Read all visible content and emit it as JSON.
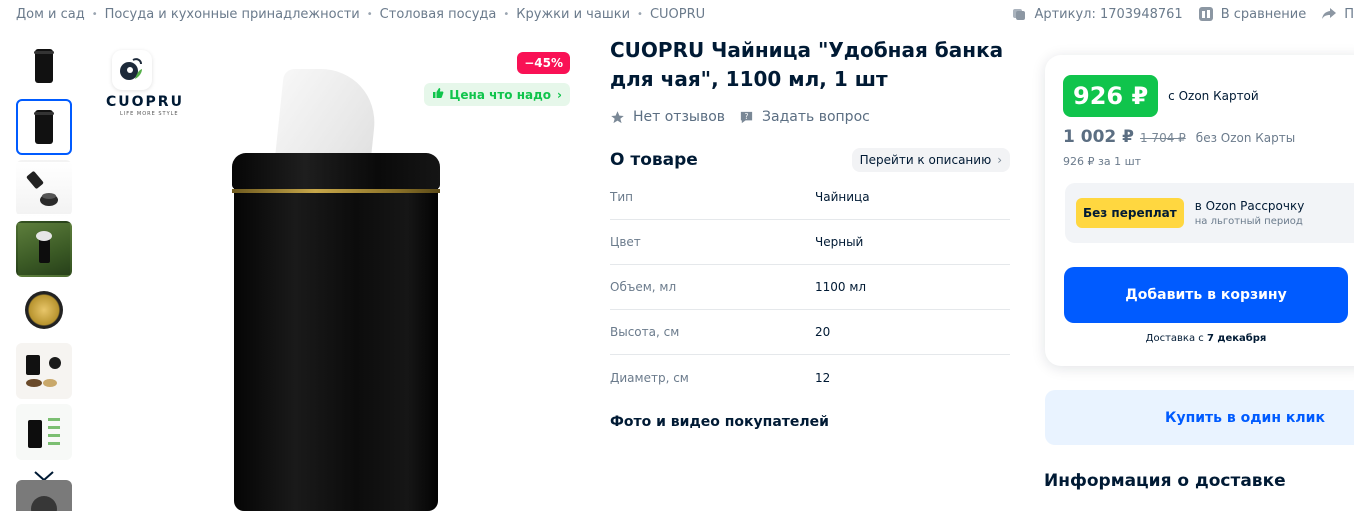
{
  "breadcrumbs": [
    "Дом и сад",
    "Посуда и кухонные принадлежности",
    "Столовая посуда",
    "Кружки и чашки",
    "CUOPRU"
  ],
  "top_actions": {
    "article": "Артикул: 1703948761",
    "compare": "В сравнение",
    "share": "П"
  },
  "gallery": {
    "thumbnails": [
      "thumb-1",
      "thumb-2",
      "thumb-3",
      "thumb-4",
      "thumb-5",
      "thumb-6",
      "thumb-7"
    ],
    "active_index": 1,
    "brand_name": "CUOPRU",
    "brand_tagline": "LIFE MORE STYLE",
    "discount_badge": "−45%",
    "good_price_badge": "Цена что надо"
  },
  "product": {
    "title": "CUOPRU Чайница \"Удобная банка для чая\", 1100 мл, 1 шт",
    "reviews": "Нет отзывов",
    "ask_question": "Задать вопрос"
  },
  "about": {
    "title": "О товаре",
    "goto_description": "Перейти к описанию",
    "specs": [
      {
        "key": "Тип",
        "value": "Чайница"
      },
      {
        "key": "Цвет",
        "value": "Черный"
      },
      {
        "key": "Объем, мл",
        "value": "1100 мл"
      },
      {
        "key": "Высота, см",
        "value": "20"
      },
      {
        "key": "Диаметр, см",
        "value": "12"
      }
    ],
    "customer_photos": "Фото и видео покупателей"
  },
  "price_card": {
    "card_price": "926 ₽",
    "card_price_caption": "с Ozon Картой",
    "price": "1 002 ₽",
    "old_price": "1 704 ₽",
    "price_caption": "без Ozon Карты",
    "unit_price": "926 ₽ за 1 шт",
    "installment_badge": "Без переплат",
    "installment_line1": "в Ozon Рассрочку",
    "installment_line2": "на льготный период",
    "add_to_cart": "Добавить в корзину",
    "delivery_note_prefix": "Доставка с ",
    "delivery_note_date": "7 декабря"
  },
  "one_click": "Купить в один клик",
  "delivery_info_title": "Информация о доставке",
  "colors": {
    "accent": "#005bff",
    "green": "#10c44c",
    "discount": "#f91155",
    "installment_badge": "#ffd740"
  }
}
